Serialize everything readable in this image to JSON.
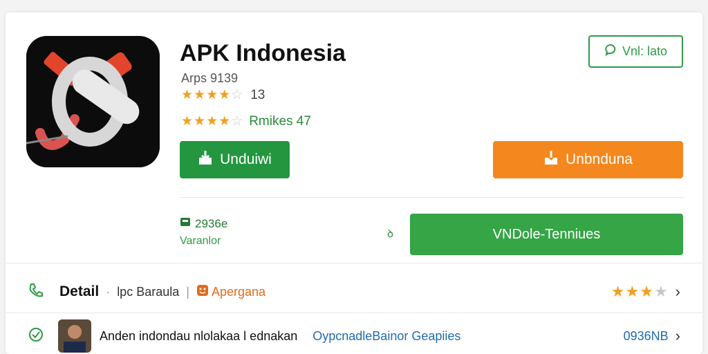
{
  "app": {
    "title": "APK Indonesia",
    "subtitle": "Arps 9139",
    "rating_count": "13",
    "reviews_text": "Rmikes 47",
    "rating1": 3.5,
    "rating2": 4
  },
  "buttons": {
    "outline": "Vnl: lato",
    "green1": "Unduiwi",
    "orange": "Unbnduna",
    "green2": "VNDole-Tenniues"
  },
  "meta": {
    "size": "2936e",
    "version": "Varanlor",
    "mid": "ꝺ"
  },
  "detail_row": {
    "title": "Detail",
    "dot": "·",
    "tab1": "lpc Baraula",
    "tab2": "Apergana",
    "rating": 2.5
  },
  "bottom_row": {
    "name": "Anden indondau nlolakaa l ednakan",
    "link": "OypcnadleBainor Geapiies",
    "count": "0936NB"
  },
  "colors": {
    "green": "#23963f",
    "orange": "#f4871d",
    "star": "#f0a020",
    "link": "#1f6bb0"
  },
  "icons": [
    "download-icon",
    "chat-bubble-icon",
    "phone-icon",
    "check-circle-icon",
    "chevron-right-icon"
  ]
}
